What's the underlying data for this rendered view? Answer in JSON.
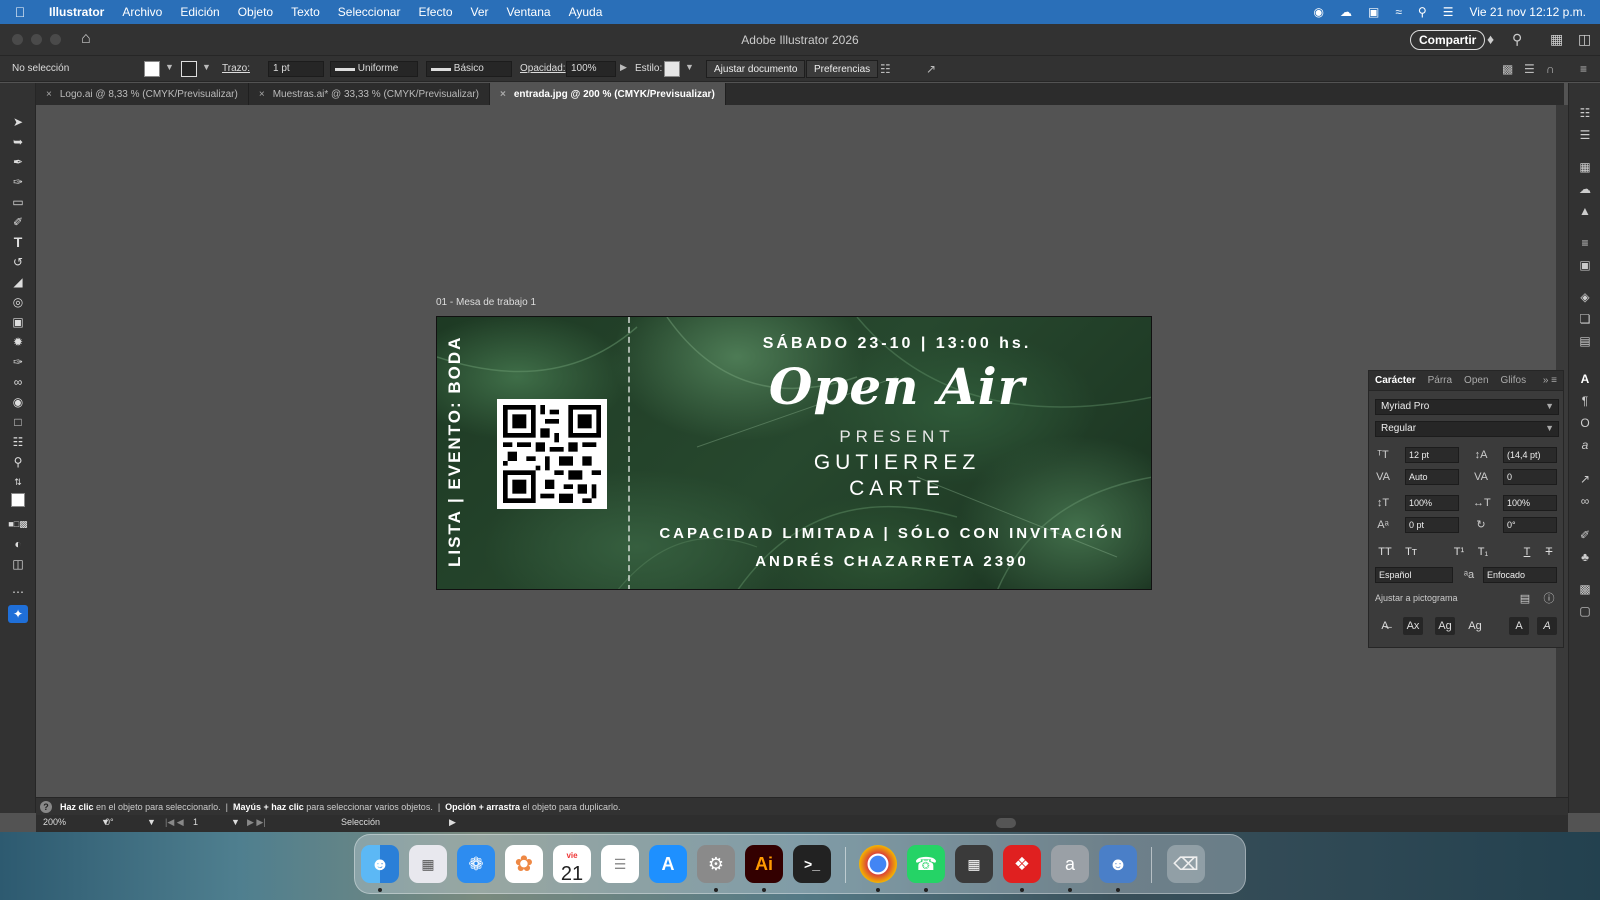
{
  "menubar": {
    "app_name": "Illustrator",
    "items": [
      "Archivo",
      "Edición",
      "Objeto",
      "Texto",
      "Seleccionar",
      "Efecto",
      "Ver",
      "Ventana",
      "Ayuda"
    ],
    "clock": "Vie 21 nov 12:12 p.m."
  },
  "window": {
    "title": "Adobe Illustrator 2026",
    "share_label": "Compartir"
  },
  "controlbar": {
    "selection_status": "No selección",
    "stroke_label": "Trazo:",
    "stroke_weight": "1 pt",
    "stroke_profile": "Uniforme",
    "brush": "Básico",
    "opacity_label": "Opacidad:",
    "opacity_value": "100%",
    "style_label": "Estilo:",
    "fit_document_label": "Ajustar documento",
    "preferences_label": "Preferencias"
  },
  "tabs": [
    {
      "label": "Logo.ai @ 8,33 % (CMYK/Previsualizar)"
    },
    {
      "label": "Muestras.ai* @ 33,33 % (CMYK/Previsualizar)"
    },
    {
      "label": "entrada.jpg @ 200 % (CMYK/Previsualizar)"
    }
  ],
  "artboard": {
    "label": "01 - Mesa de trabajo 1",
    "vertical_text": "LISTA | EVENTO: BODA",
    "date_line": "SÁBADO 23-10 | 13:00 hs.",
    "brand": "Open Air",
    "present": "PRESENT",
    "name_line1": "GUTIERREZ",
    "name_line2": "CARTE",
    "capacity_line": "CAPACIDAD LIMITADA | SÓLO CON INVITACIÓN",
    "address_line": "ANDRÉS CHAZARRETA 2390"
  },
  "character_panel": {
    "tabs": [
      "Carácter",
      "Párra",
      "Open",
      "Glifos"
    ],
    "font_family": "Myriad Pro",
    "font_style": "Regular",
    "font_size": "12 pt",
    "leading": "(14,4 pt)",
    "kerning": "Auto",
    "tracking": "0",
    "vertical_scale": "100%",
    "horizontal_scale": "100%",
    "baseline_shift": "0 pt",
    "rotation": "0°",
    "language": "Español",
    "antialias": "Enfocado",
    "snap_label": "Ajustar a pictograma"
  },
  "hint": {
    "part1_bold": "Haz clic",
    "part1": " en el objeto para seleccionarlo.  |  ",
    "part2_bold": "Mayús + haz clic",
    "part2": " para seleccionar varios objetos.  |  ",
    "part3_bold": "Opción + arrastra",
    "part3": " el objeto para duplicarlo."
  },
  "statusbar": {
    "zoom": "200%",
    "rotation": "0°",
    "artboard_number": "1",
    "tool_name": "Selección"
  },
  "dock": {
    "calendar_month": "vie",
    "calendar_day": "21",
    "illustrator_label": "Ai"
  }
}
